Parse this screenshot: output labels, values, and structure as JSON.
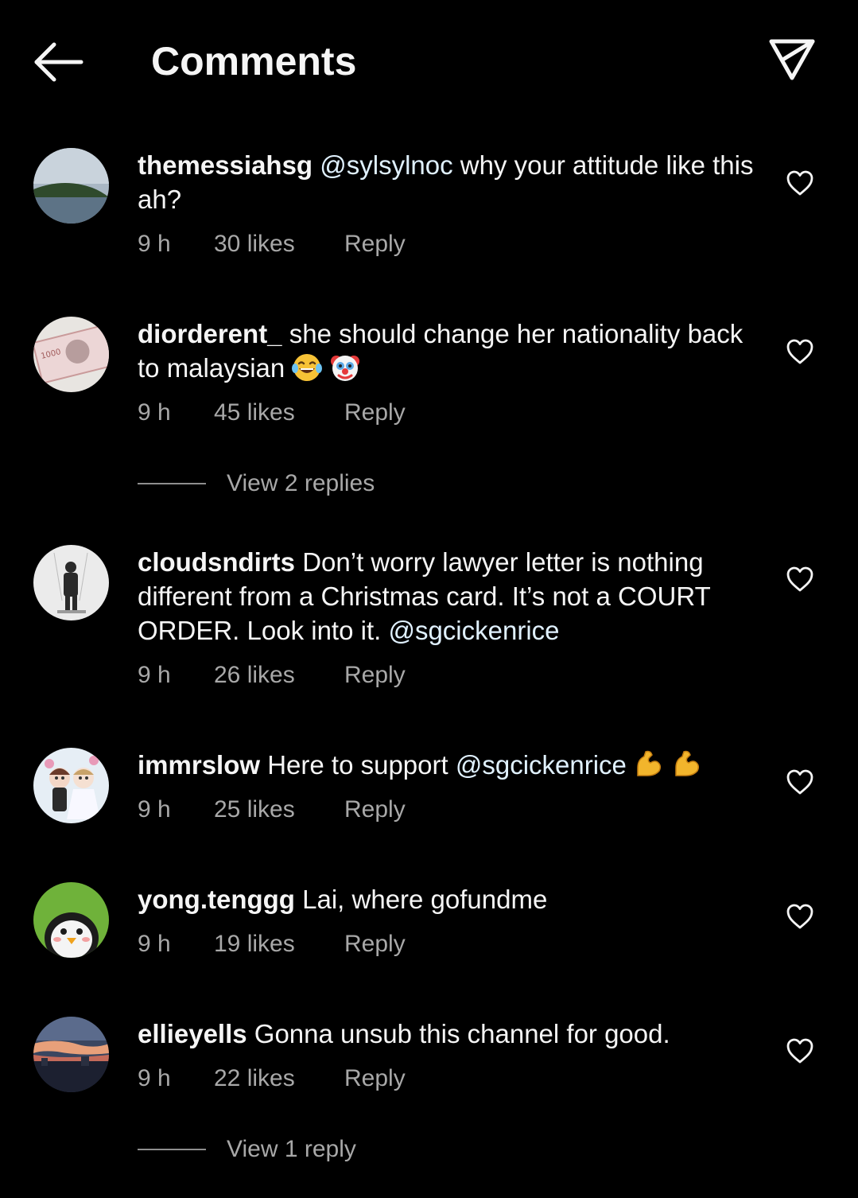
{
  "header": {
    "title": "Comments",
    "back_icon": "arrow-left-icon",
    "share_icon": "send-icon"
  },
  "comments": [
    {
      "username": "themessiahsg",
      "mention": "@sylsylnoc",
      "text": " why your attitude like this ah?",
      "time": "9 h",
      "likes": "30 likes",
      "reply": "Reply"
    },
    {
      "username": "diorderent_",
      "text": " she should change her nationality back to malaysian",
      "emojis": [
        "face-with-tears-of-joy",
        "clown-face"
      ],
      "time": "9 h",
      "likes": "45 likes",
      "reply": "Reply",
      "view_replies": "View 2 replies"
    },
    {
      "username": "cloudsndirts",
      "text": " Don’t worry lawyer letter is nothing different from a Christmas card. It’s not a COURT ORDER. Look into it. ",
      "mention": "@sgcickenrice",
      "time": "9 h",
      "likes": "26 likes",
      "reply": "Reply"
    },
    {
      "username": "immrslow",
      "text": " Here to support ",
      "mention": "@sgcickenrice",
      "emojis": [
        "flexed-biceps",
        "flexed-biceps"
      ],
      "time": "9 h",
      "likes": "25 likes",
      "reply": "Reply"
    },
    {
      "username": "yong.tenggg",
      "text": " Lai, where gofundme",
      "time": "9 h",
      "likes": "19 likes",
      "reply": "Reply"
    },
    {
      "username": "ellieyells",
      "text": " Gonna unsub this channel for good.",
      "time": "9 h",
      "likes": "22 likes",
      "reply": "Reply",
      "view_replies": "View 1 reply"
    }
  ],
  "colors": {
    "background": "#000000",
    "text": "#f5f5f5",
    "secondary": "#a8a8a8",
    "mention": "#e0f1ff"
  }
}
